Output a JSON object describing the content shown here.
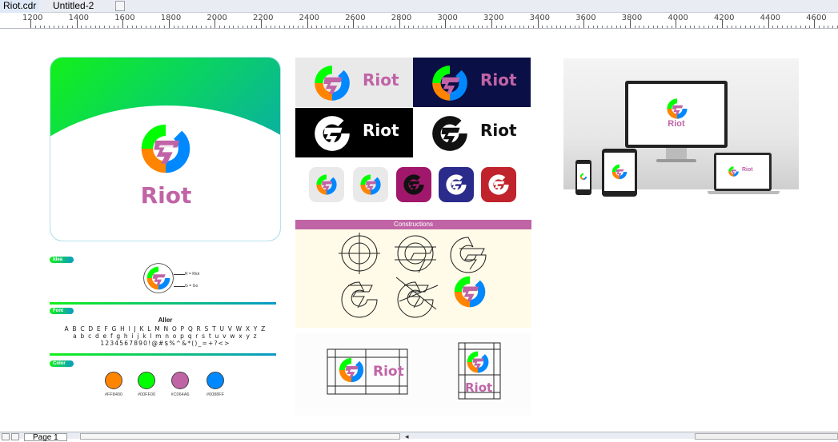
{
  "tabs": [
    {
      "label": "Riot.cdr",
      "active": true
    },
    {
      "label": "Untitled-2",
      "active": false
    }
  ],
  "ruler": {
    "labels": [
      "1200",
      "1400",
      "1600",
      "1800",
      "2000",
      "2200",
      "2400",
      "2600",
      "2800",
      "3000",
      "3200",
      "3400",
      "3600",
      "3800",
      "4000",
      "4200",
      "4400",
      "4600"
    ]
  },
  "brand": {
    "name": "Riot",
    "colors": {
      "orange": "#FF8400",
      "green": "#00FF00",
      "magenta": "#C064A6",
      "blue": "#0088FF"
    }
  },
  "guide": {
    "idea_label": "Idea",
    "r_note": "R = Riot",
    "g_note": "G = Go",
    "font_label": "Font",
    "font_name": "Aller",
    "font_upper": "A B C D E F G H I J K L M N O P Q R S T U V W X Y Z",
    "font_lower": "a b c d e f g h i j k l m n o p q r s t u v w x y z",
    "font_symbols": "1234567890!@#$%^&*()_=+?<>",
    "color_label": "Color",
    "swatches": [
      {
        "hex": "#FF8400",
        "label": "#FF8400"
      },
      {
        "hex": "#00FF00",
        "label": "#00FF00"
      },
      {
        "hex": "#C064A6",
        "label": "#C064A6"
      },
      {
        "hex": "#0088FF",
        "label": "#0088FF"
      }
    ]
  },
  "variants": [
    {
      "name": "Riot",
      "style": "color-on-light"
    },
    {
      "name": "Riot",
      "style": "color-on-dark"
    },
    {
      "name": "Riot",
      "style": "white-on-black"
    },
    {
      "name": "Riot",
      "style": "black-on-white"
    }
  ],
  "app_icons": [
    {
      "bg": "#e9e9ea",
      "style": "color"
    },
    {
      "bg": "#e9e9ea",
      "style": "color"
    },
    {
      "bg": "#a0176b",
      "style": "mono"
    },
    {
      "bg": "#2b2b8c",
      "style": "mono"
    },
    {
      "bg": "#c0232b",
      "style": "mono"
    }
  ],
  "constructions": {
    "title": "Constructions"
  },
  "status": {
    "page_tab": "Page 1"
  }
}
